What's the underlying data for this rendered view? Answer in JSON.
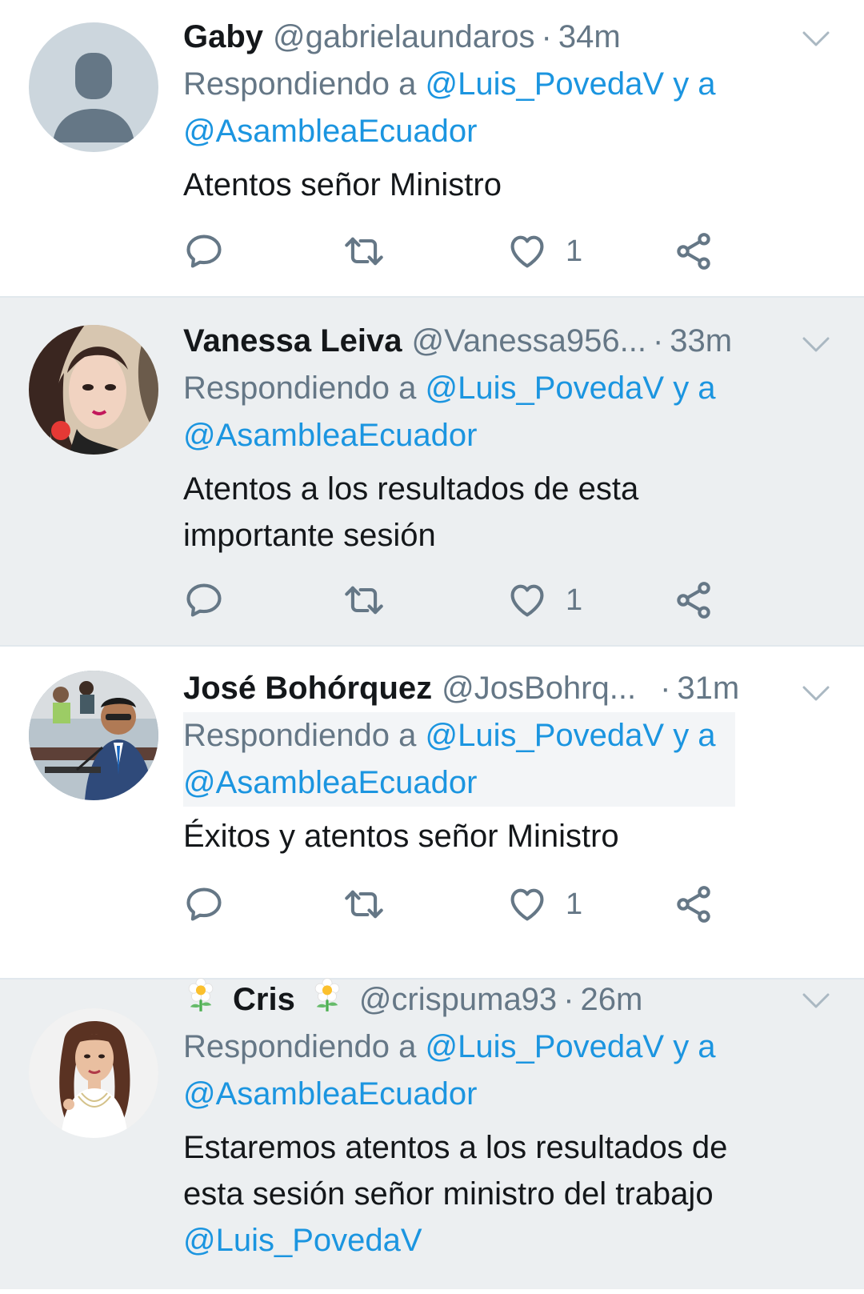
{
  "colors": {
    "link": "#1b95e0",
    "secondary_text": "#657786",
    "primary_text": "#14171a",
    "shaded_bg": "#eceff1",
    "divider": "#e1e8ed"
  },
  "tweets": [
    {
      "name": "Gaby",
      "handle": "@gabrielaundaros",
      "time": "34m",
      "reply_prefix": "Respondiendo a",
      "reply_mention_1": "@Luis_PovedaV",
      "reply_join": "y a",
      "reply_mention_2": "@AsambleaEcuador",
      "text_line_1": "Atentos señor Ministro",
      "likes": "1",
      "avatar": "default-avatar-icon"
    },
    {
      "name": "Vanessa Leiva",
      "handle": "@Vanessa956...",
      "time": "33m",
      "reply_prefix": "Respondiendo a",
      "reply_mention_1": "@Luis_PovedaV",
      "reply_join": "y a",
      "reply_mention_2": "@AsambleaEcuador",
      "text_line_1": "Atentos a los resultados de esta",
      "text_line_2": "importante sesión",
      "likes": "1",
      "avatar": "user-photo"
    },
    {
      "name": "José Bohórquez",
      "handle": "@JosBohrq...",
      "time": "31m",
      "reply_prefix": "Respondiendo a",
      "reply_mention_1": "@Luis_PovedaV",
      "reply_join": "y a",
      "reply_mention_2": "@AsambleaEcuador",
      "text_line_1": "Éxitos y atentos señor Ministro",
      "likes": "1",
      "avatar": "user-photo"
    },
    {
      "name": "Cris",
      "handle": "@crispuma93",
      "time": "26m",
      "reply_prefix": "Respondiendo a",
      "reply_mention_1": "@Luis_PovedaV",
      "reply_join": "y a",
      "reply_mention_2": "@AsambleaEcuador",
      "text_line_1": "Estaremos atentos a los resultados de",
      "text_line_2": "esta sesión señor ministro del trabajo",
      "text_mention": "@Luis_PovedaV",
      "avatar": "user-photo"
    }
  ]
}
